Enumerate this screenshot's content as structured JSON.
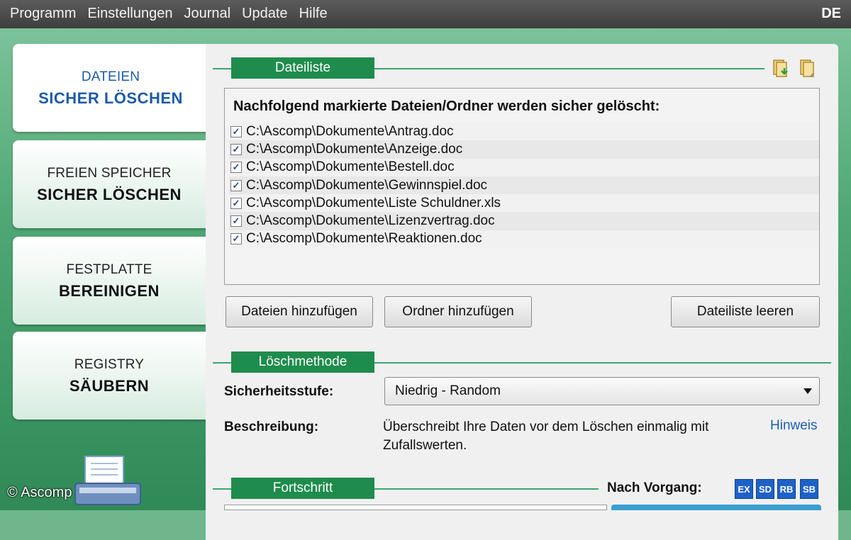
{
  "menu": {
    "items": [
      "Programm",
      "Einstellungen",
      "Journal",
      "Update",
      "Hilfe"
    ],
    "language": "DE"
  },
  "sidebar": {
    "items": [
      {
        "line1": "DATEIEN",
        "line2": "SICHER LÖSCHEN",
        "active": true
      },
      {
        "line1": "FREIEN SPEICHER",
        "line2": "SICHER LÖSCHEN",
        "active": false
      },
      {
        "line1": "FESTPLATTE",
        "line2": "BEREINIGEN",
        "active": false
      },
      {
        "line1": "REGISTRY",
        "line2": "SÄUBERN",
        "active": false
      }
    ],
    "copyright": "© Ascomp"
  },
  "filelist": {
    "section_title": "Dateiliste",
    "heading": "Nachfolgend markierte Dateien/Ordner werden sicher gelöscht:",
    "files": [
      "C:\\Ascomp\\Dokumente\\Antrag.doc",
      "C:\\Ascomp\\Dokumente\\Anzeige.doc",
      "C:\\Ascomp\\Dokumente\\Bestell.doc",
      "C:\\Ascomp\\Dokumente\\Gewinnspiel.doc",
      "C:\\Ascomp\\Dokumente\\Liste Schuldner.xls",
      "C:\\Ascomp\\Dokumente\\Lizenzvertrag.doc",
      "C:\\Ascomp\\Dokumente\\Reaktionen.doc"
    ],
    "buttons": {
      "add_files": "Dateien hinzufügen",
      "add_folder": "Ordner hinzufügen",
      "clear_list": "Dateiliste leeren"
    }
  },
  "method": {
    "section_title": "Löschmethode",
    "level_label": "Sicherheitsstufe:",
    "level_value": "Niedrig - Random",
    "desc_label": "Beschreibung:",
    "desc_text": "Überschreibt Ihre Daten vor dem Löschen einmalig mit Zufallswerten.",
    "hint_link": "Hinweis"
  },
  "progress": {
    "section_title": "Fortschritt",
    "after_label": "Nach Vorgang:",
    "options": [
      "EX",
      "SD",
      "RB",
      "SB"
    ]
  },
  "colors": {
    "accent_green": "#1e8c4c",
    "active_blue": "#1d5aa7",
    "option_blue": "#1e62c8"
  }
}
